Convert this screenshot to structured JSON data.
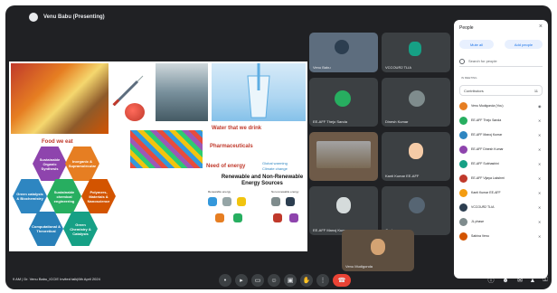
{
  "topbar": {
    "title": "Venu Babu (Presenting)"
  },
  "slide": {
    "captions": {
      "food": "Food we eat",
      "water": "Water that we drink",
      "pharma": "Pharmaceuticals",
      "need": "Need of energy",
      "global_warming": "Global warming",
      "climate_change": "Climate change",
      "energy": "Renewable and Non-Renewable Energy Sources",
      "renewable": "Renewable energy",
      "nonrenewable": "Non-renewable energy"
    },
    "hexagons": [
      {
        "label": "Sustainable Organic Synthesis",
        "color": "#8e44ad"
      },
      {
        "label": "Inorganic & Supramolecular",
        "color": "#e67e22"
      },
      {
        "label": "Green catalysis & Biochemistry",
        "color": "#2e86c1"
      },
      {
        "label": "Sustainable chemical engineering",
        "color": "#27ae60"
      },
      {
        "label": "Polymers, Materials & Nanoscience",
        "color": "#d35400"
      },
      {
        "label": "Computational & Theoretical",
        "color": "#2980b9"
      },
      {
        "label": "Green Chemistry & Catalysis",
        "color": "#16a085"
      }
    ]
  },
  "tiles": [
    {
      "name": "Venu Babu"
    },
    {
      "name": "VCCOUR2 TLIA"
    },
    {
      "name": "EE-AFF Thejo Sanda"
    },
    {
      "name": "Dinesh Kumar"
    },
    {
      "name": ""
    },
    {
      "name": "Kanti Kumar EE-AFF"
    },
    {
      "name": "EE-AFF Manoj Kumar"
    },
    {
      "name": "JL phase"
    },
    {
      "name": "Venu Mudigonda"
    }
  ],
  "bottombar": {
    "meeting": "9 AM | Dr. Venu Babu_ICCIE Invited talk|6th April 2024",
    "controls": [
      "mic-icon",
      "camera-icon",
      "captions-icon",
      "emoji-icon",
      "present-icon",
      "raise-hand-icon",
      "more-icon",
      "end-call-icon"
    ],
    "right_controls": [
      "info-icon",
      "people-icon",
      "chat-icon",
      "activities-icon",
      "lock-icon"
    ],
    "people_badge": "11"
  },
  "people_panel": {
    "title": "People",
    "add_people": "Add people",
    "mute_all": "Mute all",
    "search_placeholder": "Search for people",
    "section": "IN MEETING",
    "group_label": "Contributors",
    "group_count": "11",
    "participants": [
      {
        "name": "Venu Mudigonda (You)",
        "color": "#e67e22"
      },
      {
        "name": "EE-AFF Thejo Sanda",
        "color": "#27ae60"
      },
      {
        "name": "EE-AFF Manoj Kumar",
        "color": "#2e86c1"
      },
      {
        "name": "EE-AFF Dinesh Kumar",
        "color": "#8e44ad"
      },
      {
        "name": "EE-AFF Subhashini",
        "color": "#16a085"
      },
      {
        "name": "EE-AFF Vijaya Lakshmi",
        "color": "#c0392b"
      },
      {
        "name": "Kanti Kumar EE-AFF",
        "color": "#f39c12"
      },
      {
        "name": "VCCOUR2 TLIA",
        "color": "#2c3e50"
      },
      {
        "name": "JL phase",
        "color": "#7f8c8d"
      },
      {
        "name": "Sabina Venu",
        "color": "#d35400"
      }
    ]
  }
}
